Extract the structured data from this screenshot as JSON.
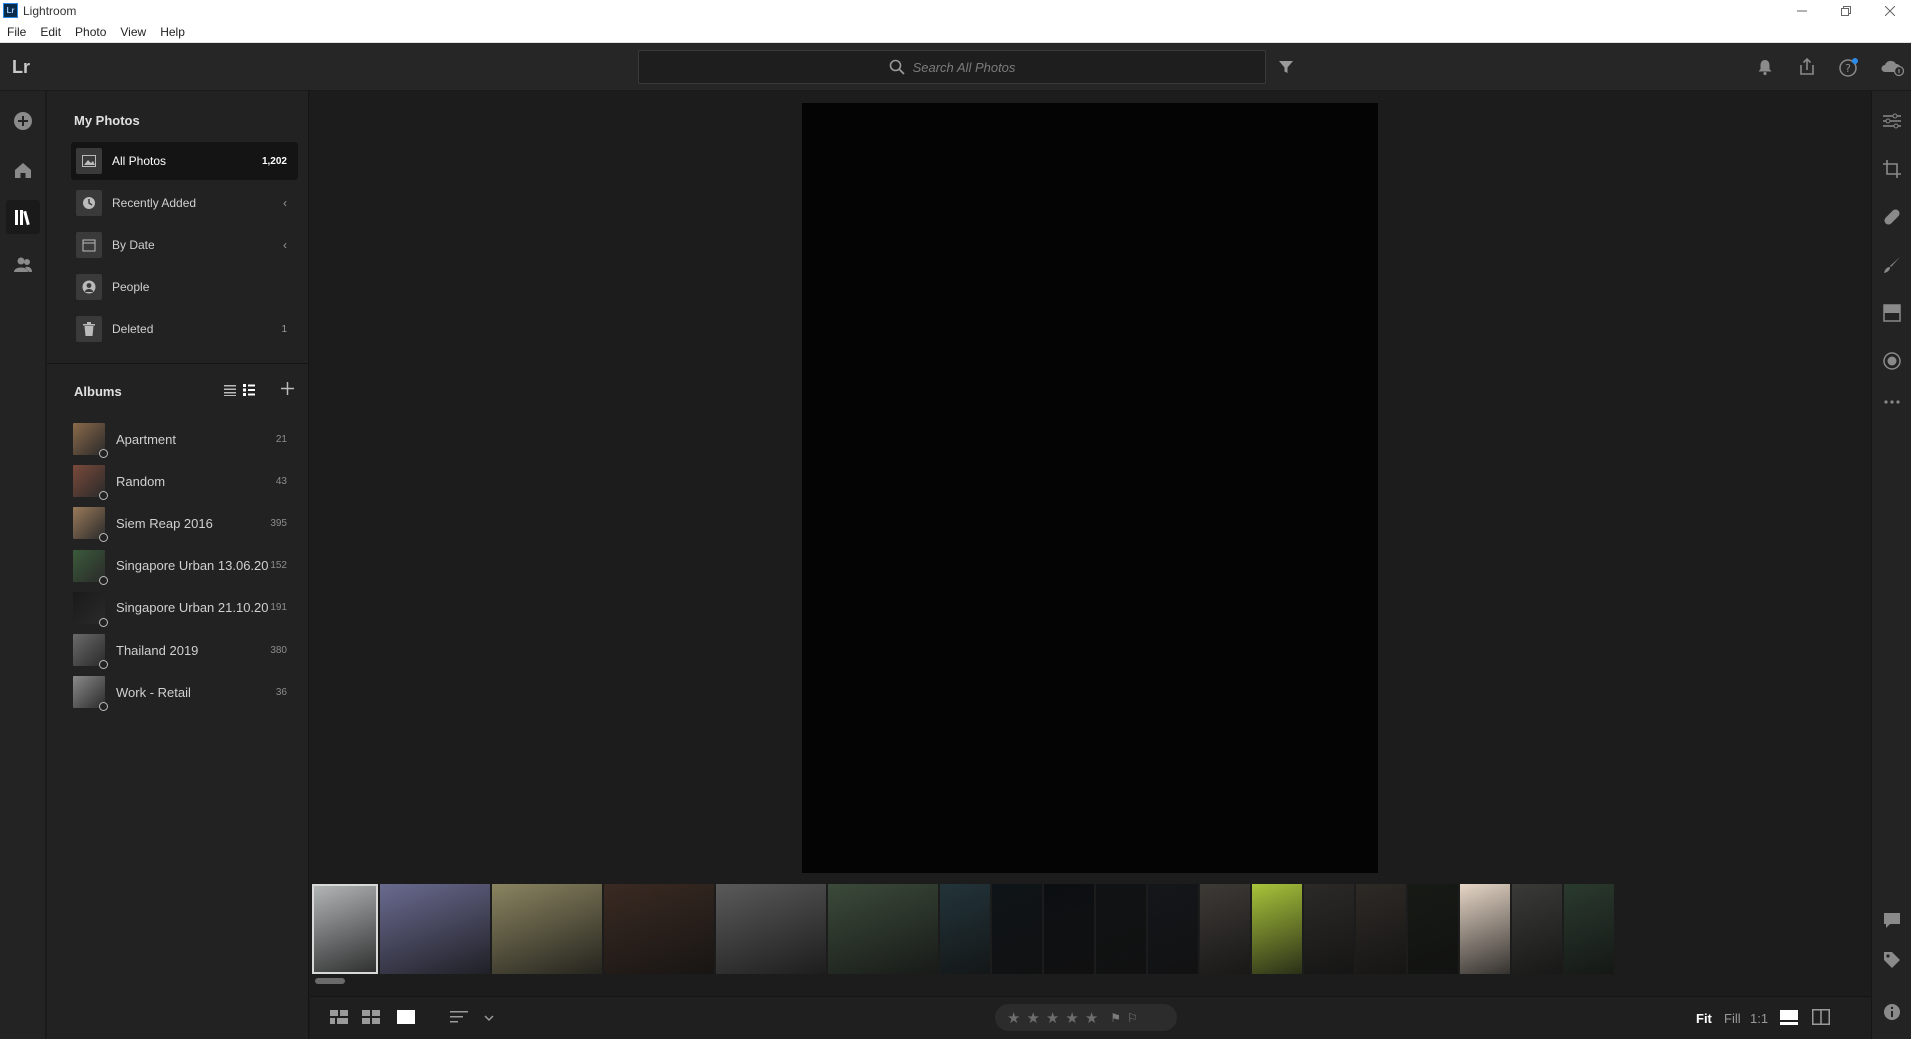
{
  "window": {
    "badge": "Lr",
    "title": "Lightroom",
    "controls": [
      "minimize",
      "restore",
      "close"
    ]
  },
  "menu": [
    "File",
    "Edit",
    "Photo",
    "View",
    "Help"
  ],
  "topbar": {
    "logo": "Lr",
    "search_placeholder": "Search All Photos",
    "icons": [
      "filter-icon",
      "bell-icon",
      "share-icon",
      "help-icon",
      "cloud-sync-icon"
    ],
    "accent": "#2b8be8"
  },
  "leftrail": {
    "icons": [
      "add-photos-icon",
      "home-icon",
      "library-icon",
      "people-icon"
    ],
    "active": "library-icon"
  },
  "my_photos": {
    "title": "My Photos",
    "items": [
      {
        "label": "All Photos",
        "count": "1,202",
        "icon": "photo-icon",
        "active": true
      },
      {
        "label": "Recently Added",
        "count": "",
        "icon": "clock-icon",
        "chevron": true
      },
      {
        "label": "By Date",
        "count": "",
        "icon": "calendar-icon",
        "chevron": true
      },
      {
        "label": "People",
        "count": "",
        "icon": "person-icon"
      },
      {
        "label": "Deleted",
        "count": "1",
        "icon": "trash-icon"
      }
    ]
  },
  "albums": {
    "title": "Albums",
    "items": [
      {
        "label": "Apartment",
        "count": "21",
        "color": "#8a6a4a"
      },
      {
        "label": "Random",
        "count": "43",
        "color": "#7a4a3a"
      },
      {
        "label": "Siem Reap 2016",
        "count": "395",
        "color": "#9a7a5a"
      },
      {
        "label": "Singapore Urban 13.06.20",
        "count": "152",
        "color": "#3a5a3a"
      },
      {
        "label": "Singapore Urban 21.10.20",
        "count": "191",
        "color": "#1a1a1a"
      },
      {
        "label": "Thailand 2019",
        "count": "380",
        "color": "#6a6a6a"
      },
      {
        "label": "Work - Retail",
        "count": "36",
        "color": "#8a8a8a"
      }
    ]
  },
  "filmstrip": [
    {
      "color": "#b5b8b9"
    },
    {
      "color": "#6a6a90"
    },
    {
      "color": "#8a8460"
    },
    {
      "color": "#3a2a22"
    },
    {
      "color": "#5a5a5a"
    },
    {
      "color": "#3b4a3a"
    },
    {
      "color": "#22343a"
    },
    {
      "color": "#0f1418"
    },
    {
      "color": "#0c0f12"
    },
    {
      "color": "#101214"
    },
    {
      "color": "#14161a"
    },
    {
      "color": "#3e3a36"
    },
    {
      "color": "#a8c43a"
    },
    {
      "color": "#2c2a28"
    },
    {
      "color": "#2e2a26"
    },
    {
      "color": "#161a14"
    },
    {
      "color": "#e6d6c6"
    },
    {
      "color": "#3a3a38"
    },
    {
      "color": "#2a3a2e"
    }
  ],
  "bottombar": {
    "view_icons": [
      "photo-grid-icon",
      "square-grid-icon",
      "detail-view-icon"
    ],
    "sort_icon": "sort-icon",
    "stars": [
      "★",
      "★",
      "★",
      "★",
      "★"
    ],
    "flags": [
      "⚑",
      "⚐"
    ],
    "zoom": [
      "Fit",
      "Fill",
      "1:1"
    ],
    "zoom_active": "Fit"
  },
  "rightrail": {
    "icons": [
      "edit-sliders-icon",
      "crop-icon",
      "healing-icon",
      "brush-icon",
      "linear-gradient-icon",
      "radial-gradient-icon",
      "more-icon",
      "comments-icon",
      "keywords-icon",
      "info-icon"
    ]
  }
}
